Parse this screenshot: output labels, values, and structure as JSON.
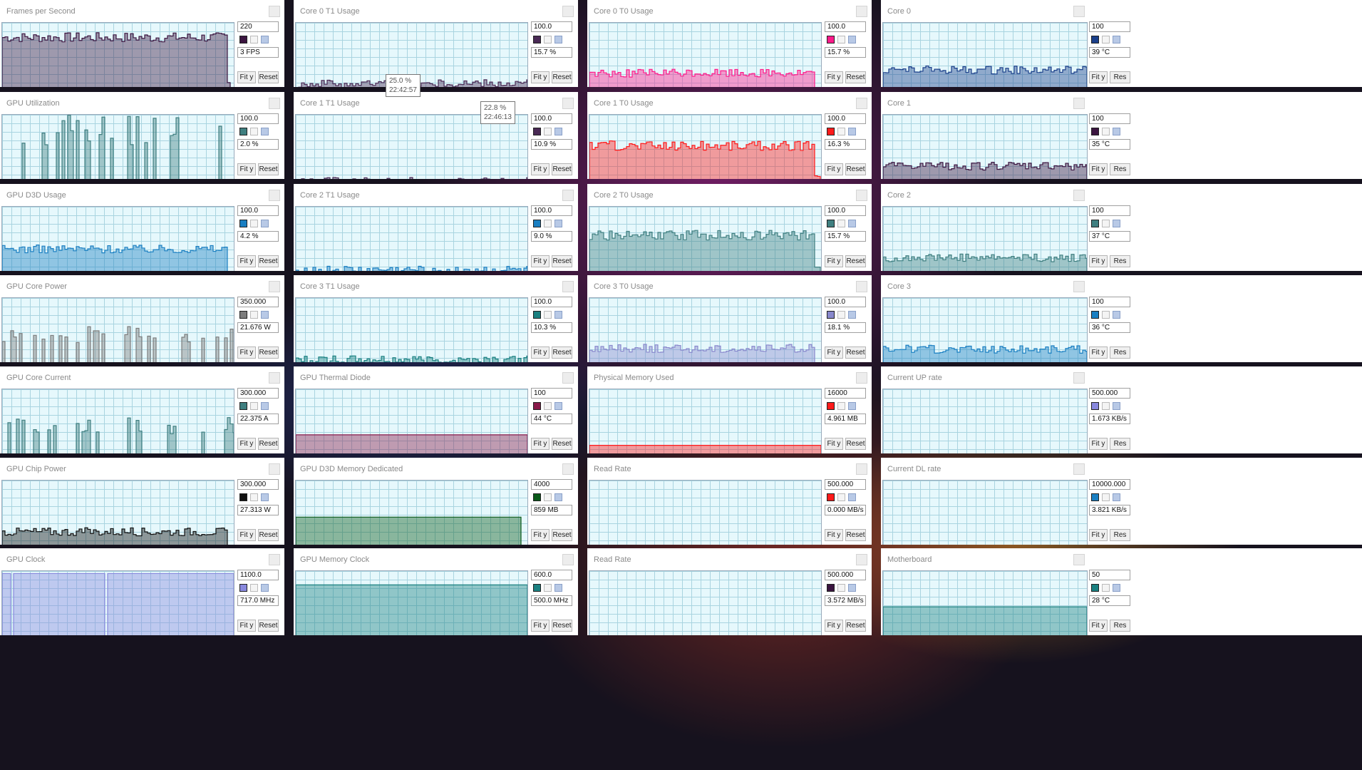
{
  "colors": {
    "fps": "#3b1540",
    "gpu_util": "#3f7f80",
    "d3d_usage": "#1a7fc2",
    "core_power": "#7d7d7d",
    "core_current": "#3f7f80",
    "chip_power": "#111111",
    "gpu_clock": "#8888dd",
    "c0t1": "#4a2a55",
    "c1t1": "#4a2a55",
    "c2t1": "#1a7fc2",
    "c3t1": "#1a8080",
    "thermal": "#8a1a4a",
    "d3d_mem": "#0a5a1a",
    "mem_clock": "#1a8080",
    "c0t0": "#ff1a8a",
    "c1t0": "#ff1a1a",
    "c2t0": "#3f7f80",
    "c3t0": "#8888cc",
    "phys_mem": "#ff1a1a",
    "read1": "#ff1a1a",
    "read2": "#3b1540",
    "core0": "#1a3f8a",
    "core1": "#3b1540",
    "core2": "#3f7f80",
    "core3": "#1a7fc2",
    "up_rate": "#8888dd",
    "dl_rate": "#1a7fc2",
    "motherboard": "#1a8080"
  },
  "panels": [
    {
      "id": "fps",
      "title": "Frames per Second",
      "max": "220",
      "current": "3 FPS",
      "min": "0",
      "fit_label": "Fit y",
      "reset_label": "Reset",
      "level": 0.82,
      "drop": true
    },
    {
      "id": "gpu_util",
      "title": "GPU Utilization",
      "max": "100.0",
      "current": "2.0 %",
      "min": "0.0",
      "fit_label": "Fit y",
      "reset_label": "Reset",
      "level": 0.65,
      "spiky": true
    },
    {
      "id": "d3d_usage",
      "title": "GPU D3D Usage",
      "max": "100.0",
      "current": "4.2 %",
      "min": "0.0",
      "fit_label": "Fit y",
      "reset_label": "Reset",
      "level": 0.48,
      "drop": true
    },
    {
      "id": "core_power",
      "title": "GPU Core Power",
      "max": "350.000",
      "current": "21.676 W",
      "min": "0.000",
      "fit_label": "Fit y",
      "reset_label": "Reset",
      "level": 0.45,
      "spiky": true
    },
    {
      "id": "core_current",
      "title": "GPU Core Current",
      "max": "300.000",
      "current": "22.375 A",
      "min": "0.000",
      "fit_label": "Fit y",
      "reset_label": "Reset",
      "level": 0.45,
      "spiky": true
    },
    {
      "id": "chip_power",
      "title": "GPU Chip Power",
      "max": "300.000",
      "current": "27.313 W",
      "min": "0.000",
      "fit_label": "Fit y",
      "reset_label": "Reset",
      "level": 0.37,
      "drop": true
    },
    {
      "id": "gpu_clock",
      "title": "GPU Clock",
      "max": "1100.0",
      "current": "717.0 MHz",
      "min": "0.0",
      "fit_label": "Fit y",
      "reset_label": "Reset",
      "level": 0.97,
      "clock": true
    },
    {
      "id": "c0t1",
      "title": "Core 0 T1 Usage",
      "max": "100.0",
      "current": "15.7 %",
      "min": "0.0",
      "fit_label": "Fit y",
      "reset_label": "Reset",
      "level": 0.25
    },
    {
      "id": "c1t1",
      "title": "Core 1 T1 Usage",
      "max": "100.0",
      "current": "10.9 %",
      "min": "0.0",
      "fit_label": "Fit y",
      "reset_label": "Reset",
      "level": 0.18
    },
    {
      "id": "c2t1",
      "title": "Core 2 T1 Usage",
      "max": "100.0",
      "current": "9.0 %",
      "min": "0.0",
      "fit_label": "Fit y",
      "reset_label": "Reset",
      "level": 0.22
    },
    {
      "id": "c3t1",
      "title": "Core 3 T1 Usage",
      "max": "100.0",
      "current": "10.3 %",
      "min": "0.0",
      "fit_label": "Fit y",
      "reset_label": "Reset",
      "level": 0.24
    },
    {
      "id": "thermal",
      "title": "GPU Thermal Diode",
      "max": "100",
      "current": "44 °C",
      "min": "0",
      "fit_label": "Fit y",
      "reset_label": "Reset",
      "level": 0.44,
      "flat": true
    },
    {
      "id": "d3d_mem",
      "title": "GPU D3D Memory Dedicated",
      "max": "4000",
      "current": "859 MB",
      "min": "0",
      "fit_label": "Fit y",
      "reset_label": "Reset",
      "level": 0.55,
      "flat": true,
      "drop": true
    },
    {
      "id": "mem_clock",
      "title": "GPU Memory Clock",
      "max": "600.0",
      "current": "500.0 MHz",
      "min": "0.0",
      "fit_label": "Fit y",
      "reset_label": "Reset",
      "level": 0.83,
      "flat": true
    },
    {
      "id": "c0t0",
      "title": "Core 0 T0 Usage",
      "max": "100.0",
      "current": "15.7 %",
      "min": "0.0",
      "fit_label": "Fit y",
      "reset_label": "Reset",
      "level": 0.38,
      "drop": true
    },
    {
      "id": "c1t0",
      "title": "Core 1 T0 Usage",
      "max": "100.0",
      "current": "16.3 %",
      "min": "0.0",
      "fit_label": "Fit y",
      "reset_label": "Reset",
      "level": 0.62,
      "drop": true
    },
    {
      "id": "c2t0",
      "title": "Core 2 T0 Usage",
      "max": "100.0",
      "current": "15.7 %",
      "min": "0.0",
      "fit_label": "Fit y",
      "reset_label": "Reset",
      "level": 0.65,
      "drop": true
    },
    {
      "id": "c3t0",
      "title": "Core 3 T0 Usage",
      "max": "100.0",
      "current": "18.1 %",
      "min": "0.0",
      "fit_label": "Fit y",
      "reset_label": "Reset",
      "level": 0.38,
      "drop": true
    },
    {
      "id": "phys_mem",
      "title": "Physical Memory Used",
      "max": "16000",
      "current": "4.961 MB",
      "min": "0",
      "fit_label": "Fit y",
      "reset_label": "Reset",
      "level": 0.31,
      "flat": true
    },
    {
      "id": "read1",
      "title": "Read Rate",
      "max": "500.000",
      "current": "0.000 MB/s",
      "min": "0.000",
      "fit_label": "Fit y",
      "reset_label": "Reset",
      "level": 0.0,
      "flat": true
    },
    {
      "id": "read2",
      "title": "Read Rate",
      "max": "500.000",
      "current": "3.572 MB/s",
      "min": "0.000",
      "fit_label": "Fit y",
      "reset_label": "Reset",
      "level": 0.0,
      "flat": true
    },
    {
      "id": "core0",
      "title": "Core 0",
      "max": "100",
      "current": "39 °C",
      "min": "0",
      "fit_label": "Fit y",
      "reset_label": "Res",
      "level": 0.42
    },
    {
      "id": "core1",
      "title": "Core 1",
      "max": "100",
      "current": "35 °C",
      "min": "0",
      "fit_label": "Fit y",
      "reset_label": "Res",
      "level": 0.37
    },
    {
      "id": "core2",
      "title": "Core 2",
      "max": "100",
      "current": "37 °C",
      "min": "0",
      "fit_label": "Fit y",
      "reset_label": "Res",
      "level": 0.37
    },
    {
      "id": "core3",
      "title": "Core 3",
      "max": "100",
      "current": "36 °C",
      "min": "0",
      "fit_label": "Fit y",
      "reset_label": "Res",
      "level": 0.37
    },
    {
      "id": "up_rate",
      "title": "Current UP rate",
      "max": "500.000",
      "current": "1.673 KB/s",
      "min": "0.000",
      "fit_label": "Fit y",
      "reset_label": "Res",
      "level": 0.0,
      "flat": true
    },
    {
      "id": "dl_rate",
      "title": "Current DL rate",
      "max": "10000.000",
      "current": "3.821 KB/s",
      "min": "0.000",
      "fit_label": "Fit y",
      "reset_label": "Res",
      "level": 0.0,
      "flat": true
    },
    {
      "id": "motherboard",
      "title": "Motherboard",
      "max": "50",
      "current": "28 °C",
      "min": "0",
      "fit_label": "Fit y",
      "reset_label": "Res",
      "level": 0.56,
      "flat": true
    }
  ],
  "tooltips": [
    {
      "value": "25.0 %",
      "time": "22:42:57"
    },
    {
      "value": "22.8 %",
      "time": "22:46:13"
    }
  ]
}
